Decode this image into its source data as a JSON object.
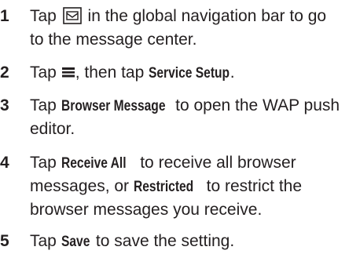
{
  "steps": [
    {
      "number": "1",
      "lines": [
        {
          "pre": "Tap ",
          "icon": "message-center-icon",
          "post": " in the global navigation bar to go"
        },
        {
          "text": "to the message center."
        }
      ]
    },
    {
      "number": "2",
      "pre": "Tap ",
      "icon": "menu-icon",
      "mid": ", then tap ",
      "keyword": "Service Setup",
      "post": "."
    },
    {
      "number": "3",
      "pre": "Tap ",
      "keyword": "Browser Message",
      "post": " to open the WAP push",
      "line2": "editor."
    },
    {
      "number": "4",
      "pre": "Tap ",
      "keyword": "Receive All",
      "post": " to receive all browser",
      "line2_pre": "messages, or ",
      "line2_keyword": "Restricted",
      "line2_post": " to restrict the",
      "line3": "browser messages you receive."
    },
    {
      "number": "5",
      "pre": "Tap ",
      "keyword": "Save",
      "post": " to save the setting."
    }
  ]
}
